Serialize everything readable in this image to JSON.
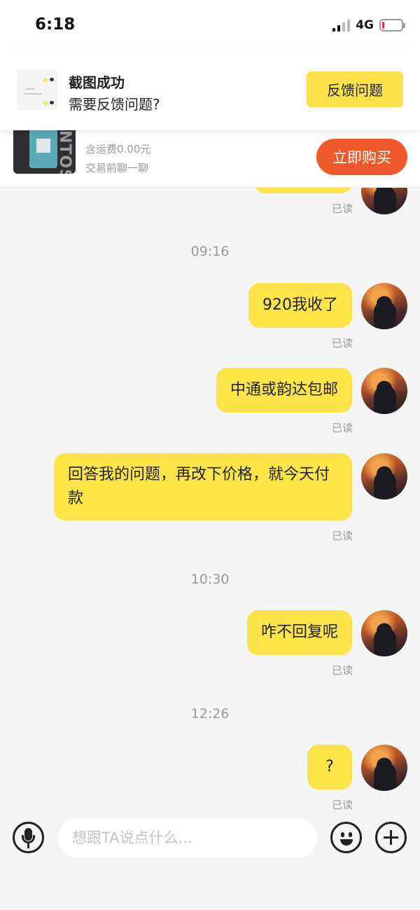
{
  "status_bar": {
    "time": "6:18",
    "network": "4G",
    "battery_fraction": 0.12
  },
  "feedback": {
    "title": "截图成功",
    "subtitle": "需要反馈问题?",
    "button_label": "反馈问题"
  },
  "product": {
    "shipping": "含运费0.00元",
    "chat_hint": "交易前聊一聊",
    "buy_label": "立即购买",
    "thumb_text": "NTOSP"
  },
  "chat": {
    "read_label": "已读",
    "time_separators": [
      "09:16",
      "10:30",
      "12:26"
    ],
    "messages": [
      {
        "text": "920我收了",
        "status": "已读"
      },
      {
        "text": "中通或韵达包邮",
        "status": "已读"
      },
      {
        "text": "回答我的问题，再改下价格，就今天付款",
        "status": "已读"
      },
      {
        "text": "咋不回复呢",
        "status": "已读"
      },
      {
        "text": "?",
        "status": "已读"
      }
    ]
  },
  "input": {
    "placeholder": "想跟TA说点什么..."
  },
  "colors": {
    "bubble": "#fde449",
    "feedback_button": "#fde04a",
    "buy_button": "#f0592b"
  }
}
